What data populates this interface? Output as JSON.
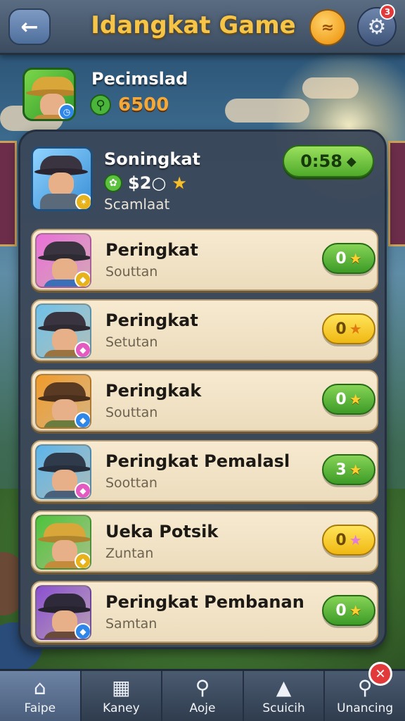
{
  "header": {
    "title": "Idangkat Game",
    "back_icon": "arrow-left-icon",
    "notification_count": "3"
  },
  "player": {
    "name": "Pecimslad",
    "score": "6500"
  },
  "featured": {
    "name": "Soningkat",
    "amount": "$2○",
    "subtitle": "Scamlaat",
    "timer": "0:58"
  },
  "rows": [
    {
      "title": "Peringkat",
      "subtitle": "Souttan",
      "value": "0",
      "pill": "green",
      "star": "gold",
      "avatar_bg": "#e86fd8",
      "hat": "#3a3440",
      "shirt": "#3b6fb8",
      "badge_color": "#e7b21a"
    },
    {
      "title": "Peringkat",
      "subtitle": "Setutan",
      "value": "0",
      "pill": "yellow",
      "star": "gold",
      "avatar_bg": "#6ec0e8",
      "hat": "#3a3440",
      "shirt": "#9b7340",
      "badge_color": "#e35ac0"
    },
    {
      "title": "Peringkak",
      "subtitle": "Souttan",
      "value": "0",
      "pill": "green",
      "star": "gold",
      "avatar_bg": "#f09a2a",
      "hat": "#5a3a22",
      "shirt": "#6b7d3e",
      "badge_color": "#2e86e8"
    },
    {
      "title": "Peringkat Pemalasl",
      "subtitle": "Soottan",
      "value": "3",
      "pill": "green",
      "star": "gold",
      "avatar_bg": "#5bb4ea",
      "hat": "#2f3a4a",
      "shirt": "#4a5f7a",
      "badge_color": "#e35ac0"
    },
    {
      "title": "Ueka Potsik",
      "subtitle": "Zuntan",
      "value": "0",
      "pill": "yellow",
      "star": "pink",
      "avatar_bg": "#4cc23a",
      "hat": "#d9a63a",
      "shirt": "#c48c3a",
      "badge_color": "#e7b21a"
    },
    {
      "title": "Peringkat Pembanan",
      "subtitle": "Samtan",
      "value": "0",
      "pill": "green",
      "star": "gold",
      "avatar_bg": "#8a4fd0",
      "hat": "#2f2a3a",
      "shirt": "#6a4a3a",
      "badge_color": "#2e86e8"
    }
  ],
  "nav": [
    {
      "label": "Faipe",
      "icon": "home-icon"
    },
    {
      "label": "Kaney",
      "icon": "map-icon"
    },
    {
      "label": "Aoje",
      "icon": "search-icon"
    },
    {
      "label": "Scuicih",
      "icon": "megaphone-icon"
    },
    {
      "label": "Unancing",
      "icon": "magnifier-icon"
    }
  ]
}
